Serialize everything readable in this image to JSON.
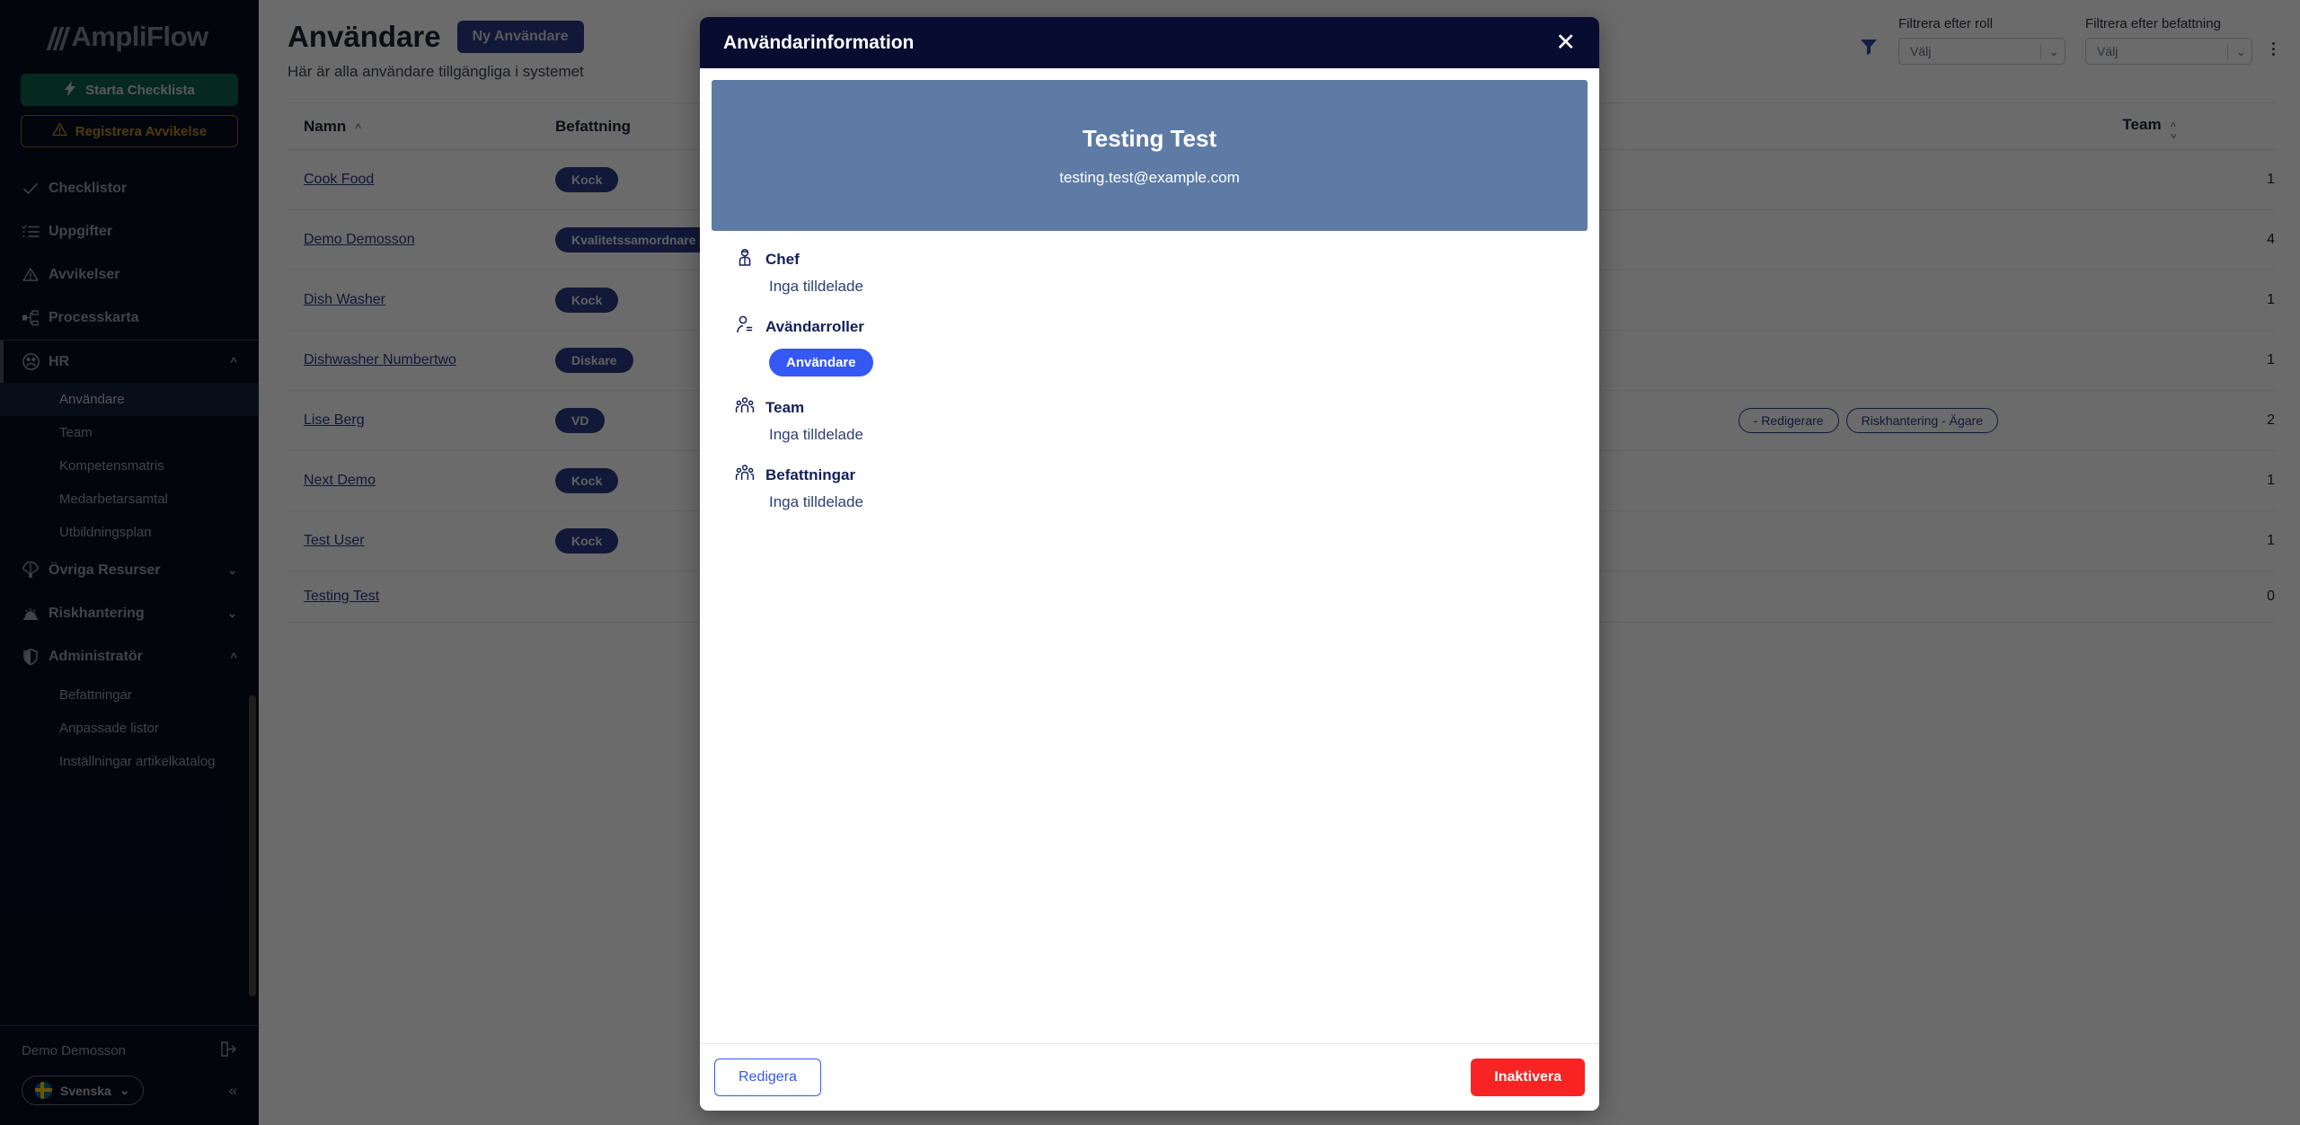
{
  "sidebar": {
    "brand": "AmpliFlow",
    "start_checklist": "Starta Checklista",
    "register_deviation": "Registrera Avvikelse",
    "nav": [
      {
        "label": "Checklistor",
        "icon": "check-icon",
        "expandable": false
      },
      {
        "label": "Uppgifter",
        "icon": "task-list-icon",
        "expandable": false
      },
      {
        "label": "Avvikelser",
        "icon": "warning-triangle-icon",
        "expandable": false
      },
      {
        "label": "Processkarta",
        "icon": "process-map-icon",
        "expandable": false
      },
      {
        "label": "HR",
        "icon": "people-icon",
        "expandable": true,
        "chevron": "up"
      },
      {
        "label": "Övriga Resurser",
        "icon": "parachute-icon",
        "expandable": true,
        "chevron": "down"
      },
      {
        "label": "Riskhantering",
        "icon": "alarm-icon",
        "expandable": true,
        "chevron": "down"
      },
      {
        "label": "Administratör",
        "icon": "shield-icon",
        "expandable": true,
        "chevron": "up"
      }
    ],
    "hr_children": [
      "Användare",
      "Team",
      "Kompetensmatris",
      "Medarbetarsamtal",
      "Utbildningsplan"
    ],
    "hr_selected": "Användare",
    "admin_children": [
      "Befattningar",
      "Anpassade listor",
      "Inställningar artikelkatalog"
    ],
    "user_name": "Demo Demosson",
    "language": "Svenska"
  },
  "page": {
    "title": "Användare",
    "new_user_button": "Ny Användare",
    "subtitle": "Här är alla användare tillgängliga i systemet",
    "filters": [
      {
        "label": "Filtrera efter roll",
        "value": "Välj"
      },
      {
        "label": "Filtrera efter befattning",
        "value": "Välj"
      }
    ],
    "columns": {
      "name": "Namn",
      "position": "Befattning",
      "team": "Team"
    },
    "rows": [
      {
        "name": "Cook Food",
        "position": "Kock",
        "roles": [],
        "team": "1"
      },
      {
        "name": "Demo Demosson",
        "position": "Kvalitetssamordnare",
        "roles": [],
        "team": "4"
      },
      {
        "name": "Dish Washer",
        "position": "Kock",
        "roles": [],
        "team": "1"
      },
      {
        "name": "Dishwasher Numbertwo",
        "position": "Diskare",
        "roles": [],
        "team": "1"
      },
      {
        "name": "Lise Berg",
        "position": "VD",
        "roles": [
          "- Redigerare",
          "Riskhantering - Ägare"
        ],
        "team": "2"
      },
      {
        "name": "Next Demo",
        "position": "Kock",
        "roles": [],
        "team": "1"
      },
      {
        "name": "Test User",
        "position": "Kock",
        "roles": [],
        "team": "1"
      },
      {
        "name": "Testing Test",
        "position": "",
        "roles": [],
        "team": "0"
      }
    ]
  },
  "modal": {
    "title": "Användarinformation",
    "close_label": "✕",
    "hero_name": "Testing Test",
    "hero_email": "testing.test@example.com",
    "sections": [
      {
        "icon": "manager-icon",
        "label": "Chef",
        "value": "Inga tilldelade",
        "badge": null
      },
      {
        "icon": "user-role-icon",
        "label": "Avändarroller",
        "value": null,
        "badge": "Användare"
      },
      {
        "icon": "team-icon",
        "label": "Team",
        "value": "Inga tilldelade",
        "badge": null
      },
      {
        "icon": "team-icon",
        "label": "Befattningar",
        "value": "Inga tilldelade",
        "badge": null
      }
    ],
    "edit_button": "Redigera",
    "deactivate_button": "Inaktivera"
  },
  "colors": {
    "sidebar_bg": "#080c21",
    "modal_header": "#080c30",
    "hero_bg": "#5d7ba5",
    "accent_blue": "#3358f4",
    "pill_blue": "#2b3a84",
    "danger_red": "#f82323",
    "green": "#0d5f4d",
    "amber": "#b8901f"
  }
}
